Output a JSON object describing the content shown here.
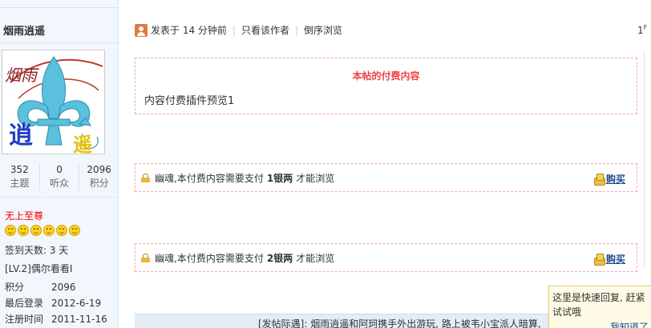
{
  "user": {
    "name": "烟雨逍遥",
    "stats": [
      {
        "value": "352",
        "label": "主题"
      },
      {
        "value": "0",
        "label": "听众"
      },
      {
        "value": "2096",
        "label": "积分"
      }
    ],
    "rank": "无上至尊",
    "star_count": 6,
    "signin": "签到天数: 3 天",
    "medal": "[LV.2]偶尔看看I",
    "info": [
      {
        "key": "积分",
        "value": "2096"
      },
      {
        "key": "最后登录",
        "value": "2012-6-19"
      },
      {
        "key": "注册时间",
        "value": "2011-11-16"
      }
    ],
    "avatar_text": {
      "left": "烟雨",
      "bottom_left": "逍",
      "bottom_right": "遥"
    }
  },
  "post": {
    "meta": {
      "posted": "发表于 14 分钟前",
      "only_author": "只看该作者",
      "reverse": "倒序浏览"
    },
    "floor": "1",
    "floor_sup": "F",
    "pay_preview": {
      "title": "本帖的付费内容",
      "body": "内容付费插件预览1"
    },
    "paid_blocks": [
      {
        "prefix": "幽魂,本付费内容需要支付",
        "price": "1银两",
        "suffix": "才能浏览",
        "buy": "购买"
      },
      {
        "prefix": "幽魂,本付费内容需要支付",
        "price": "2银两",
        "suffix": "才能浏览",
        "buy": "购买"
      }
    ]
  },
  "notice": "[发帖际遇]: 烟雨逍遥和阿珂携手外出游玩, 路上被韦小宝派人暗算,",
  "tip": {
    "line1": "这里是快速回复, 赶紧",
    "line2": "试试哦",
    "close": "我知道了"
  }
}
